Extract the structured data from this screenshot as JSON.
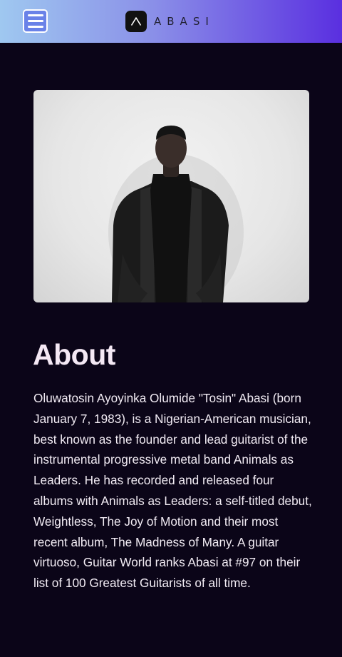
{
  "header": {
    "brand": "ABASI",
    "menu_icon": "hamburger-menu-icon",
    "logo_icon": "abasi-logo-icon",
    "gradient_start": "#9fc8f0",
    "gradient_end": "#5a2fe0"
  },
  "hero": {
    "photo": "portrait-photo"
  },
  "about": {
    "title": "About",
    "body": "Oluwatosin Ayoyinka Olumide \"Tosin\" Abasi (born January 7, 1983), is a Nigerian-American musician, best known as the founder and lead guitarist of the instrumental progressive metal band Animals as Leaders. He has recorded and released four albums with Animals as Leaders: a self-titled debut, Weightless, The Joy of Motion and their most recent album, The Madness of Many. A guitar virtuoso, Guitar World ranks Abasi at #97 on their list of 100 Greatest Guitarists of all time."
  },
  "colors": {
    "background": "#0b0518",
    "text": "#f2ecf4"
  }
}
